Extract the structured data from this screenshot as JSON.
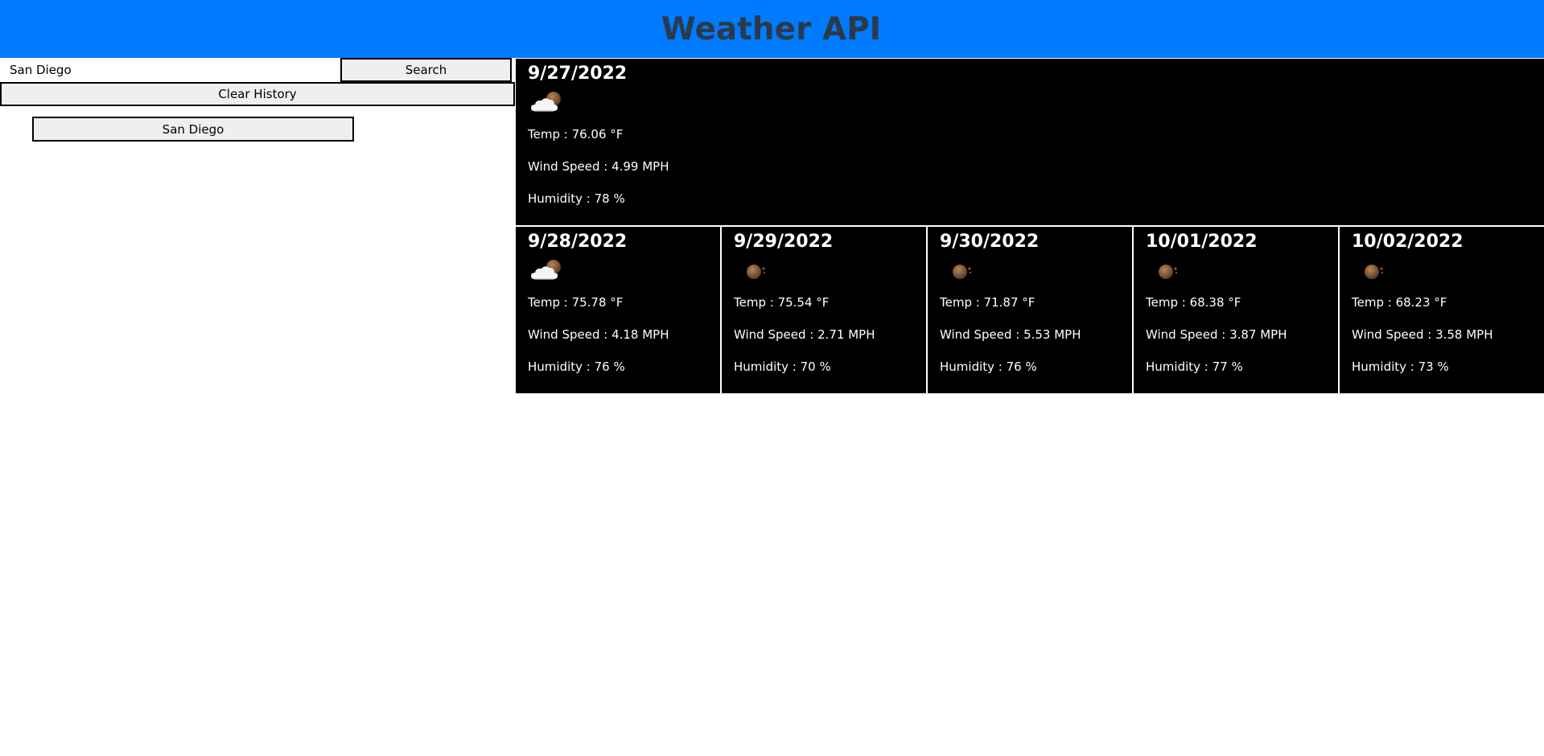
{
  "header": {
    "title": "Weather API"
  },
  "search": {
    "value": "San Diego",
    "button_label": "Search"
  },
  "clear_history_label": "Clear History",
  "history": [
    "San Diego"
  ],
  "today": {
    "date": "9/27/2022",
    "icon": "cloud-moon-icon",
    "temp": "Temp : 76.06 °F",
    "wind": "Wind Speed : 4.99 MPH",
    "humidity": "Humidity : 78 %"
  },
  "forecast": [
    {
      "date": "9/28/2022",
      "icon": "cloud-moon-icon",
      "temp": "Temp : 75.78 °F",
      "wind": "Wind Speed : 4.18 MPH",
      "humidity": "Humidity : 76 %"
    },
    {
      "date": "9/29/2022",
      "icon": "moon-icon",
      "temp": "Temp : 75.54 °F",
      "wind": "Wind Speed : 2.71 MPH",
      "humidity": "Humidity : 70 %"
    },
    {
      "date": "9/30/2022",
      "icon": "moon-icon",
      "temp": "Temp : 71.87 °F",
      "wind": "Wind Speed : 5.53 MPH",
      "humidity": "Humidity : 76 %"
    },
    {
      "date": "10/01/2022",
      "icon": "moon-icon",
      "temp": "Temp : 68.38 °F",
      "wind": "Wind Speed : 3.87 MPH",
      "humidity": "Humidity : 77 %"
    },
    {
      "date": "10/02/2022",
      "icon": "moon-icon",
      "temp": "Temp : 68.23 °F",
      "wind": "Wind Speed : 3.58 MPH",
      "humidity": "Humidity : 73 %"
    }
  ],
  "colors": {
    "header_bg": "#007bff",
    "title_text": "#2b3a4a",
    "card_bg": "#000000",
    "card_text": "#ffffff",
    "button_bg": "#efefef"
  }
}
